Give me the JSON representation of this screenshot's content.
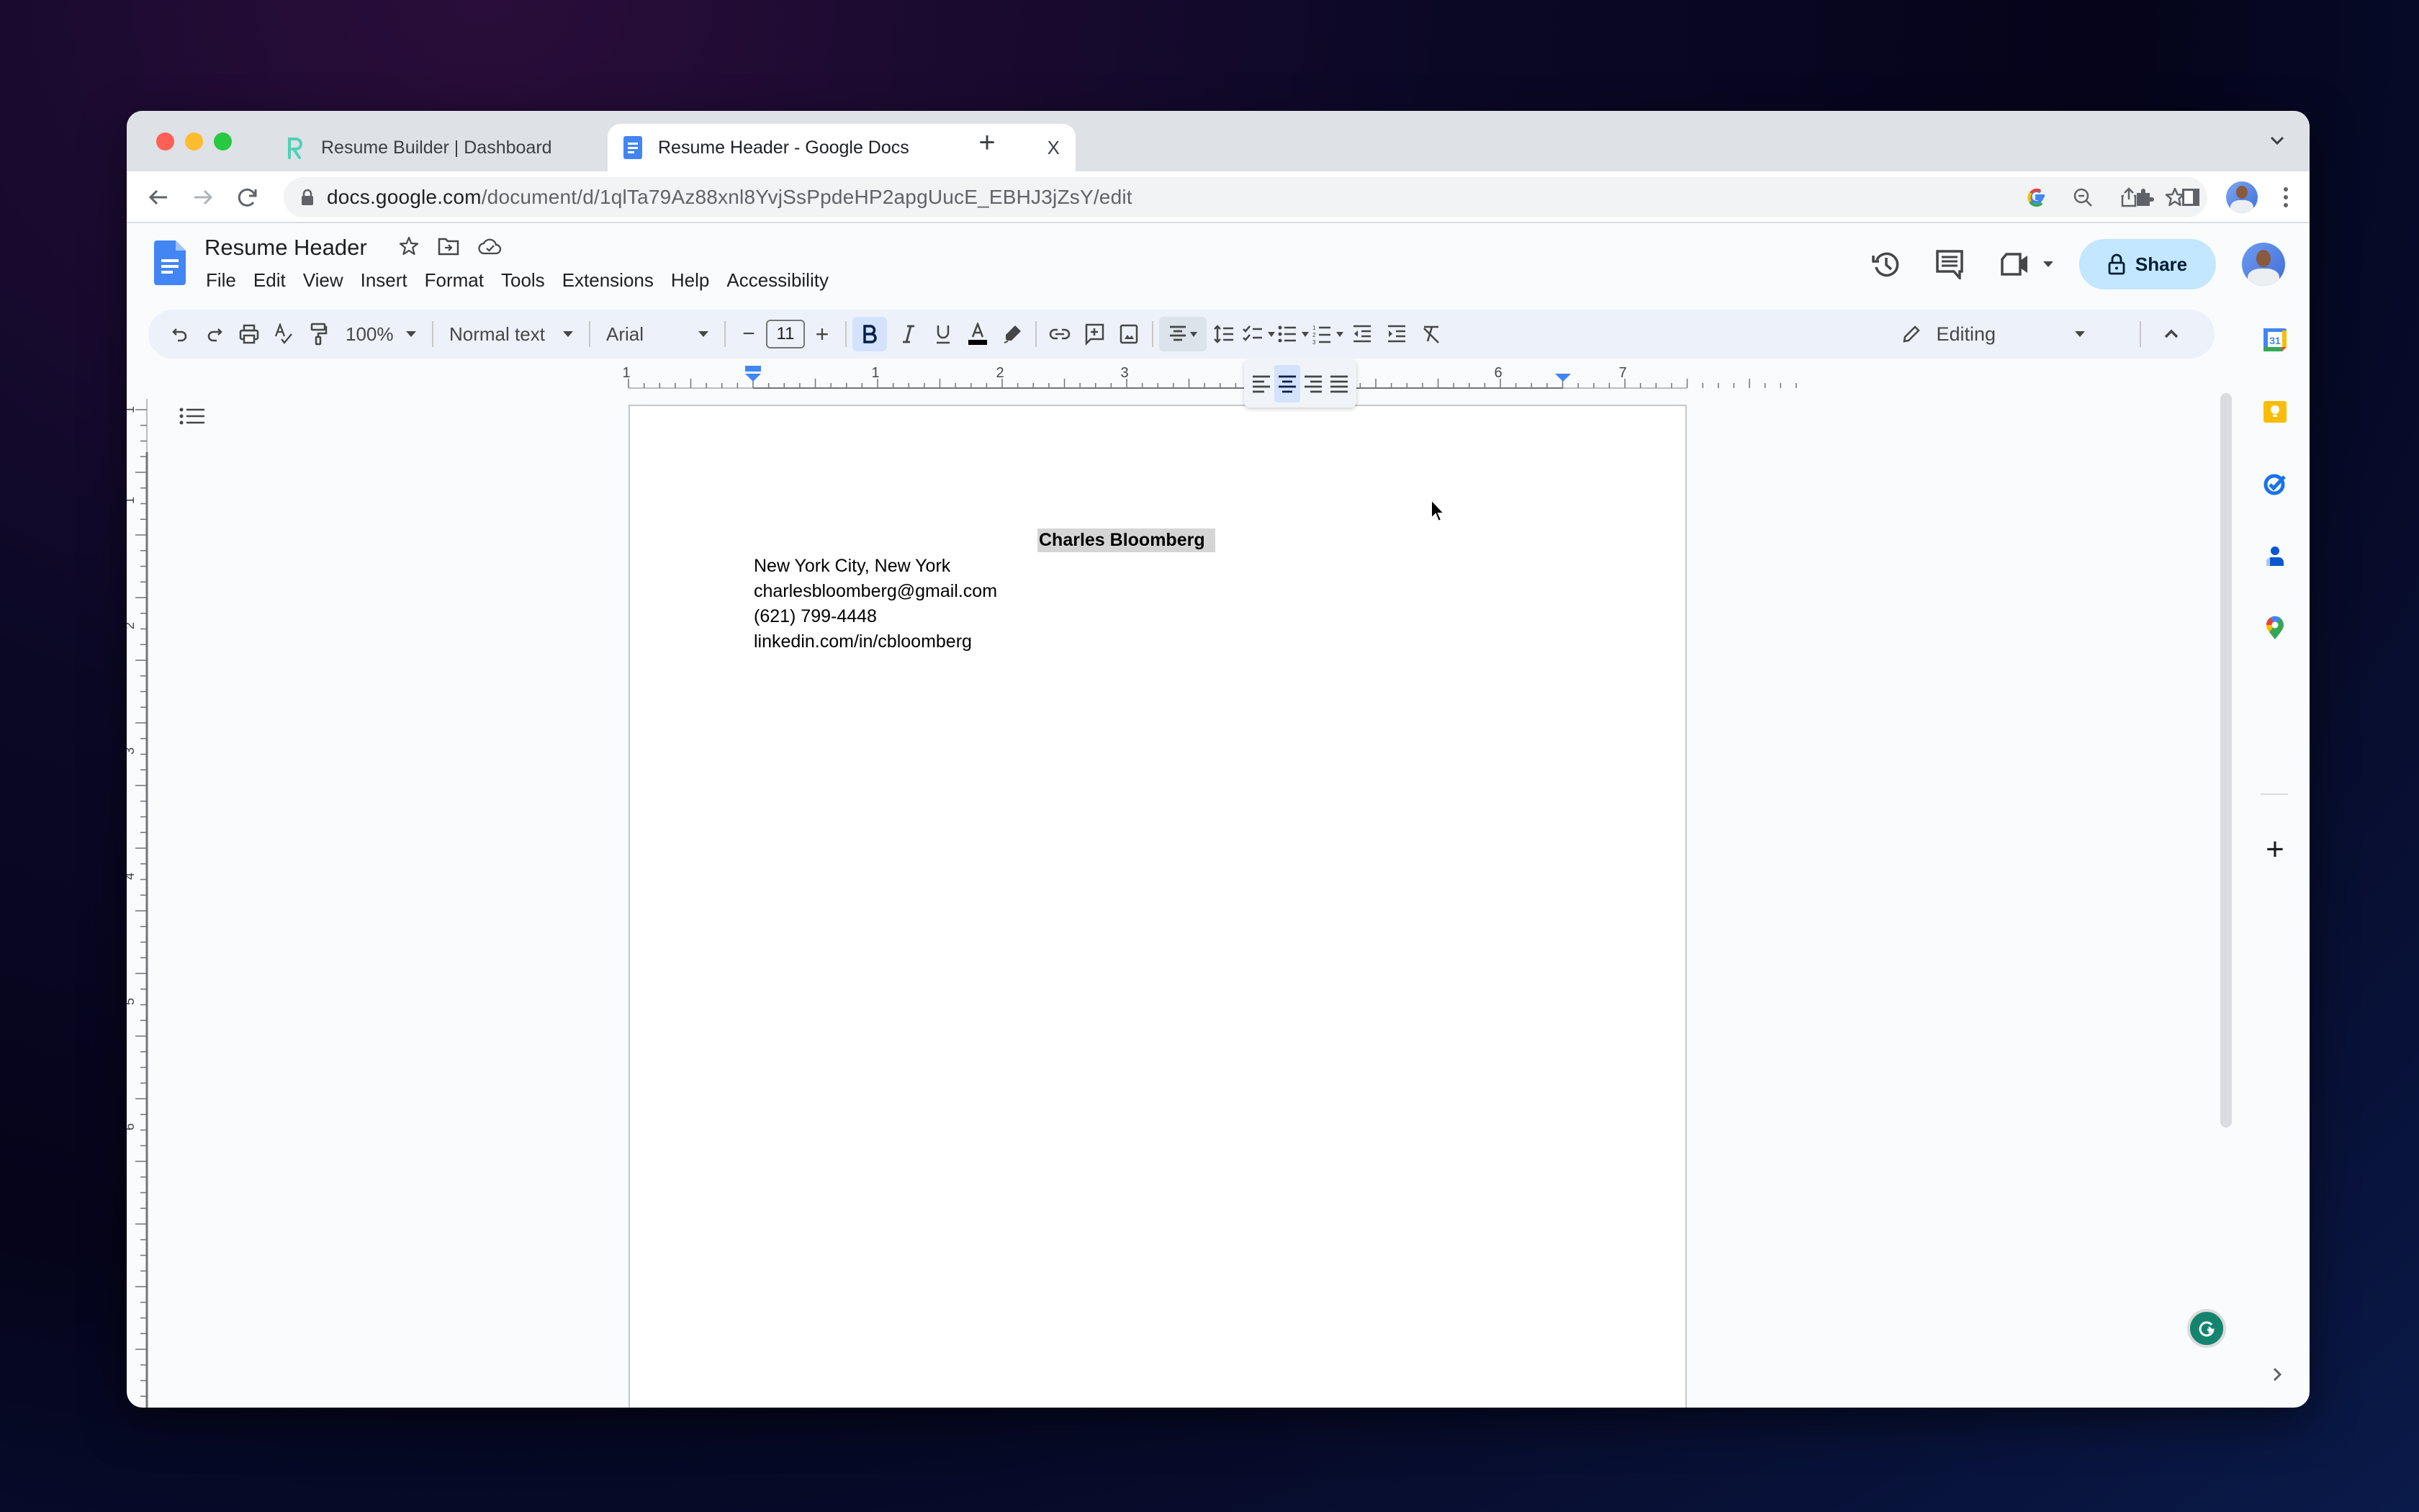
{
  "browser": {
    "tabs": [
      {
        "title": "Resume Builder | Dashboard",
        "favicon": "resume-builder-logo",
        "active": false
      },
      {
        "title": "Resume Header - Google Docs",
        "favicon": "google-docs-icon",
        "active": true
      }
    ],
    "close_glyph": "X",
    "new_tab_glyph": "+",
    "url": {
      "host": "docs.google.com",
      "path": "/document/d/1qlTa79Az88xnl8YvjSsPpdeHP2apgUucE_EBHJ3jZsY/edit"
    },
    "omnibox_icons": [
      "google-lens-icon",
      "zoom-out-icon",
      "share-icon",
      "bookmark-star-icon"
    ],
    "toolbar_icons": [
      "extensions-puzzle-icon",
      "side-panel-icon",
      "profile-avatar",
      "more-vert-icon"
    ]
  },
  "docs": {
    "title": "Resume Header",
    "menu": [
      "File",
      "Edit",
      "View",
      "Insert",
      "Format",
      "Tools",
      "Extensions",
      "Help",
      "Accessibility"
    ],
    "share_label": "Share",
    "toolbar": {
      "zoom": "100%",
      "style": "Normal text",
      "font": "Arial",
      "font_size": "11",
      "decrease_glyph": "−",
      "increase_glyph": "+",
      "bold_active": true,
      "mode": "Editing",
      "text_color": "#000000"
    },
    "align_menu": {
      "options": [
        "align-left",
        "align-center",
        "align-right",
        "justify"
      ],
      "selected": "align-center"
    },
    "ruler": {
      "labels": [
        "1",
        "1",
        "2",
        "3",
        "6",
        "7"
      ]
    },
    "vertical_ruler": {
      "labels": [
        "1",
        "1",
        "2",
        "3",
        "4",
        "5",
        "6"
      ]
    },
    "content": {
      "name": "Charles Bloomberg",
      "lines": [
        "New York City, New York",
        "charlesbloomberg@gmail.com",
        "(621) 799-4448",
        "linkedin.com/in/cbloomberg"
      ]
    }
  },
  "side_panel": {
    "apps": [
      "google-calendar-icon",
      "google-keep-icon",
      "google-tasks-icon",
      "google-contacts-icon",
      "google-maps-icon"
    ],
    "calendar_day": "31",
    "add_glyph": "+"
  },
  "colors": {
    "share_bg": "#c2e7ff",
    "toolbar_bg": "#edf2fa",
    "accent_blue": "#4285f4",
    "selected_bg": "#d3e3fd",
    "grammarly": "#15846f"
  }
}
